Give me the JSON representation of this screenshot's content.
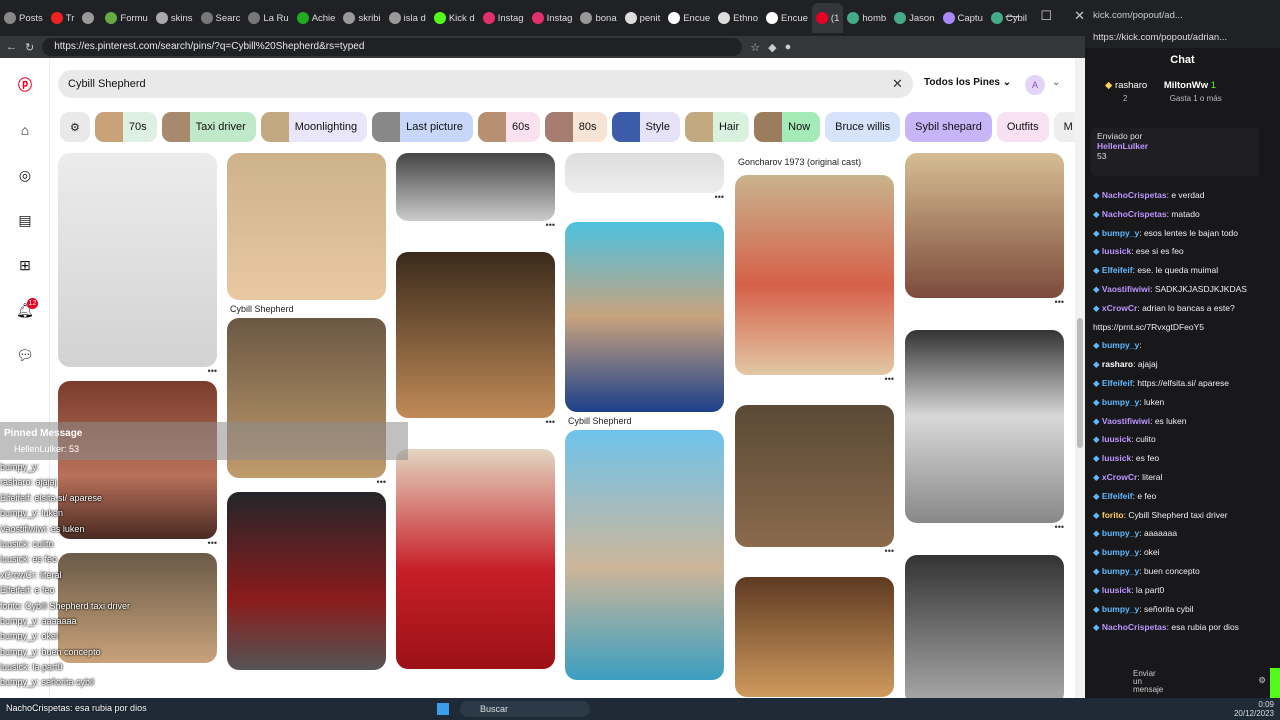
{
  "browser": {
    "tabs": [
      {
        "label": "Posts",
        "color": "#888"
      },
      {
        "label": "Tr",
        "color": "#e22"
      },
      {
        "label": "",
        "color": "#999"
      },
      {
        "label": "Formu",
        "color": "#6a4"
      },
      {
        "label": "skins",
        "color": "#aaa"
      },
      {
        "label": "Searc",
        "color": "#777"
      },
      {
        "label": "La Ru",
        "color": "#777"
      },
      {
        "label": "Achie",
        "color": "#2a2"
      },
      {
        "label": "skribi",
        "color": "#999"
      },
      {
        "label": "isla d",
        "color": "#999"
      },
      {
        "label": "Kick d",
        "color": "#53fc18"
      },
      {
        "label": "Instag",
        "color": "#e1306c"
      },
      {
        "label": "Instag",
        "color": "#e1306c"
      },
      {
        "label": "bona",
        "color": "#999"
      },
      {
        "label": "penit",
        "color": "#ddd"
      },
      {
        "label": "Encue",
        "color": "#fff"
      },
      {
        "label": "Ethno",
        "color": "#ddd"
      },
      {
        "label": "Encue",
        "color": "#fff"
      },
      {
        "label": "(1",
        "color": "#e60023"
      },
      {
        "label": "homb",
        "color": "#4a8"
      },
      {
        "label": "Jason",
        "color": "#4a8"
      },
      {
        "label": "Captu",
        "color": "#a8f"
      },
      {
        "label": "Cybil",
        "color": "#4a8"
      }
    ],
    "url": "https://es.pinterest.com/search/pins/?q=Cybill%20Shepherd&rs=typed"
  },
  "chat_window": {
    "url": "https://kick.com/popout/adrian...",
    "tab_title": "kick.com/popout/ad..."
  },
  "pinterest": {
    "search_value": "Cybill Shepherd",
    "filter_label": "Todos los Pines",
    "avatar_letter": "A",
    "notif_count": "12",
    "chips": [
      {
        "label": "70s",
        "bg": "#ddf0e3",
        "th": "#c9a27a"
      },
      {
        "label": "Taxi driver",
        "bg": "#bfe9c8",
        "th": "#a78a6d"
      },
      {
        "label": "Moonlighting",
        "bg": "#e9e6f9",
        "th": "#c3a882"
      },
      {
        "label": "Last picture",
        "bg": "#c8d6f9",
        "th": "#888"
      },
      {
        "label": "60s",
        "bg": "#f9e1ef",
        "th": "#b69070"
      },
      {
        "label": "80s",
        "bg": "#f6e4d6",
        "th": "#a77c70"
      },
      {
        "label": "Style",
        "bg": "#e6e2f7",
        "th": "#3c5ba8"
      },
      {
        "label": "Hair",
        "bg": "#d9f2de",
        "th": "#c3a97f"
      },
      {
        "label": "Now",
        "bg": "#a4ebb8",
        "th": "#9b7c5d"
      },
      {
        "label": "Bruce willis",
        "bg": "#d6e3fa",
        "th": null
      },
      {
        "label": "Sybil shepard",
        "bg": "#c8b5f7",
        "th": null
      },
      {
        "label": "Outfits",
        "bg": "#f8e1f2",
        "th": null
      },
      {
        "label": "M",
        "bg": "#eee",
        "th": null
      }
    ],
    "captions": {
      "c2p1": "Cybill Shepherd",
      "c4p2": "Cybill Shepherd",
      "c5top": "Goncharov 1973 (original cast)"
    }
  },
  "stream_overlay": {
    "pinned_title": "Pinned Message",
    "pinned_user": "HellenLulker: 53",
    "lines": [
      "bumpy_y: ",
      "rasharo: ajajaj",
      "Elfeifeif: elsita.si/ aparese",
      "bumpy_y: luken",
      "Vaostifiwiwi: es luken",
      "luusick: culito",
      "luusick: es feo",
      "xCrowCr: literal",
      "Elfeifeif: e feo",
      "forito: Cybill Shepherd taxi driver",
      "bumpy_y: aaaaaaa",
      "bumpy_y: okei",
      "bumpy_y: buen concepto",
      "luusick: la part0",
      "bumpy_y: señorita cybil"
    ],
    "bottom_line": "NachoCrispetas: esa rubia por dios"
  },
  "chat": {
    "title": "Chat",
    "leader1": "rasharo",
    "leader1_count": "2",
    "leader2": "MiltonWw",
    "leader2_count": "1",
    "leader_sub": "Gasta 1 o más",
    "pinned_by": "Enviado por",
    "pinned_user": "HellenLulker",
    "pinned_msg": "53",
    "messages": [
      {
        "u": "NachoCrispetas",
        "t": ": e verdad",
        "c": "#bf94ff"
      },
      {
        "u": "NachoCrispetas",
        "t": ": matado",
        "c": "#bf94ff"
      },
      {
        "u": "bumpy_y",
        "t": ": esos lentes le bajan todo",
        "c": "#5fb8ff"
      },
      {
        "u": "luusick",
        "t": ": ese si es feo",
        "c": "#bf94ff"
      },
      {
        "u": "Elfeifeif",
        "t": ": ese. le queda muimal",
        "c": "#5fb8ff"
      },
      {
        "u": "Vaostifiwiwi",
        "t": ": SADKJKJASDJKJKDAS",
        "c": "#bf94ff"
      },
      {
        "u": "xCrowCr",
        "t": ": adrian lo bancas a este?",
        "c": "#bf94ff"
      },
      {
        "u": "",
        "t": "https://prnt.sc/7RvxgtDFeoY5",
        "c": "#fff"
      },
      {
        "u": "bumpy_y",
        "t": ": ",
        "c": "#5fb8ff"
      },
      {
        "u": "rasharo",
        "t": ": ajajaj",
        "c": "#fff"
      },
      {
        "u": "Elfeifeif",
        "t": ": https://elfsita.si/ aparese",
        "c": "#5fb8ff"
      },
      {
        "u": "bumpy_y",
        "t": ": luken",
        "c": "#5fb8ff"
      },
      {
        "u": "Vaostifiwiwi",
        "t": ": es luken",
        "c": "#bf94ff"
      },
      {
        "u": "luusick",
        "t": ": culito",
        "c": "#bf94ff"
      },
      {
        "u": "luusick",
        "t": ": es feo",
        "c": "#bf94ff"
      },
      {
        "u": "xCrowCr",
        "t": ": literal",
        "c": "#bf94ff"
      },
      {
        "u": "Elfeifeif",
        "t": ": e feo",
        "c": "#5fb8ff"
      },
      {
        "u": "forito",
        "t": ": Cybill Shepherd taxi driver",
        "c": "#ffd15c"
      },
      {
        "u": "bumpy_y",
        "t": ": aaaaaaa",
        "c": "#5fb8ff"
      },
      {
        "u": "bumpy_y",
        "t": ": okei",
        "c": "#5fb8ff"
      },
      {
        "u": "bumpy_y",
        "t": ": buen concepto",
        "c": "#5fb8ff"
      },
      {
        "u": "luusick",
        "t": ": la part0",
        "c": "#bf94ff"
      },
      {
        "u": "bumpy_y",
        "t": ": señorita cybil",
        "c": "#5fb8ff"
      },
      {
        "u": "NachoCrispetas",
        "t": ": esa rubia por dios",
        "c": "#bf94ff"
      }
    ],
    "send_label": "Enviar un mensaje"
  },
  "taskbar": {
    "search": "Buscar",
    "time": "0:09",
    "date": "20/12/2023"
  },
  "colors": {
    "pinterest_red": "#e60023",
    "kick_green": "#53fc18"
  }
}
